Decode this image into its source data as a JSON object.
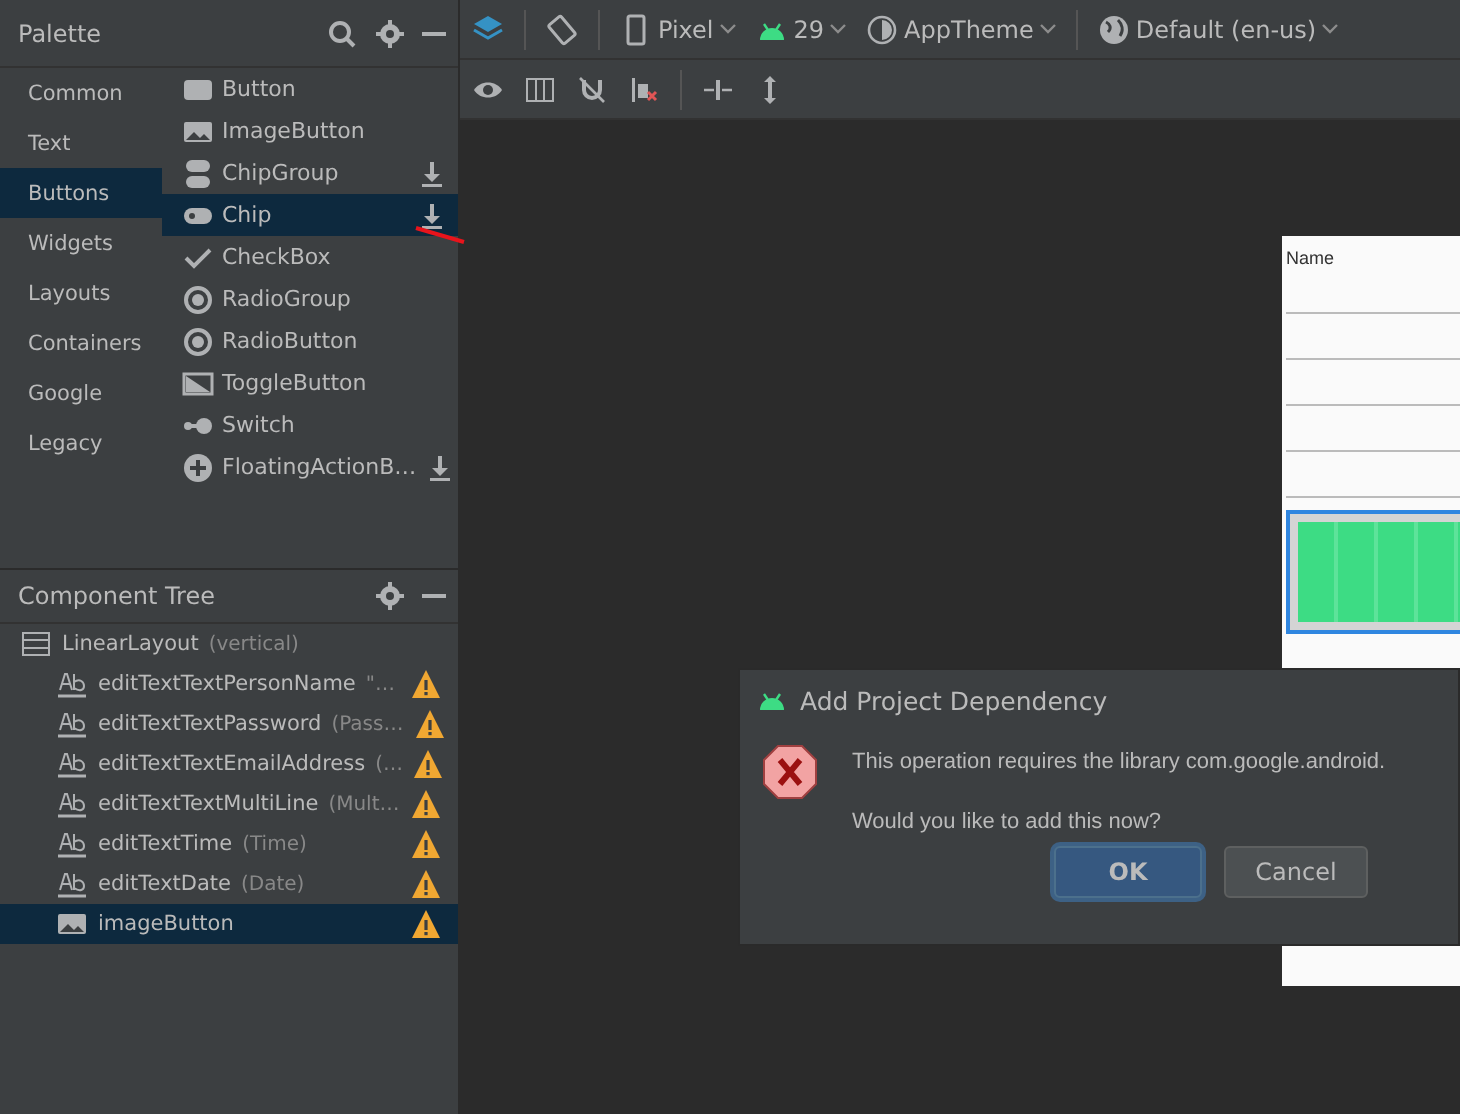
{
  "palette": {
    "title": "Palette",
    "categories": [
      {
        "label": "Common",
        "selected": false
      },
      {
        "label": "Text",
        "selected": false
      },
      {
        "label": "Buttons",
        "selected": true
      },
      {
        "label": "Widgets",
        "selected": false
      },
      {
        "label": "Layouts",
        "selected": false
      },
      {
        "label": "Containers",
        "selected": false
      },
      {
        "label": "Google",
        "selected": false
      },
      {
        "label": "Legacy",
        "selected": false
      }
    ],
    "items": [
      {
        "label": "Button",
        "kind": "button",
        "download": false,
        "selected": false
      },
      {
        "label": "ImageButton",
        "kind": "image",
        "download": false,
        "selected": false
      },
      {
        "label": "ChipGroup",
        "kind": "chipgroup",
        "download": true,
        "selected": false
      },
      {
        "label": "Chip",
        "kind": "chip",
        "download": true,
        "selected": true
      },
      {
        "label": "CheckBox",
        "kind": "check",
        "download": false,
        "selected": false
      },
      {
        "label": "RadioGroup",
        "kind": "radio",
        "download": false,
        "selected": false
      },
      {
        "label": "RadioButton",
        "kind": "radio",
        "download": false,
        "selected": false
      },
      {
        "label": "ToggleButton",
        "kind": "toggle",
        "download": false,
        "selected": false
      },
      {
        "label": "Switch",
        "kind": "switch",
        "download": false,
        "selected": false
      },
      {
        "label": "FloatingActionB…",
        "kind": "plus",
        "download": true,
        "selected": false
      }
    ]
  },
  "component_tree": {
    "title": "Component Tree",
    "root": {
      "label": "LinearLayout",
      "hint": "(vertical)",
      "children": [
        {
          "label": "editTextTextPersonName",
          "hint": "\"…",
          "kind": "text",
          "warning": true,
          "selected": false
        },
        {
          "label": "editTextTextPassword",
          "hint": "(Pass…",
          "kind": "text",
          "warning": true,
          "selected": false
        },
        {
          "label": "editTextTextEmailAddress",
          "hint": "(…",
          "kind": "text",
          "warning": true,
          "selected": false
        },
        {
          "label": "editTextTextMultiLine",
          "hint": "(Mult…",
          "kind": "text",
          "warning": true,
          "selected": false
        },
        {
          "label": "editTextTime",
          "hint": "(Time)",
          "kind": "text",
          "warning": true,
          "selected": false
        },
        {
          "label": "editTextDate",
          "hint": "(Date)",
          "kind": "text",
          "warning": true,
          "selected": false
        },
        {
          "label": "imageButton",
          "kind": "image",
          "warning": true,
          "selected": true
        }
      ]
    }
  },
  "toolbar": {
    "device": "Pixel",
    "api": "29",
    "theme": "AppTheme",
    "locale": "Default (en-us)"
  },
  "preview": {
    "header": "Name"
  },
  "dialog": {
    "title": "Add Project Dependency",
    "message": "This operation requires the library com.google.android.",
    "question": "Would you like to add this now?",
    "buttons": [
      {
        "label": "OK",
        "default": true
      },
      {
        "label": "Cancel",
        "default": false
      }
    ]
  }
}
